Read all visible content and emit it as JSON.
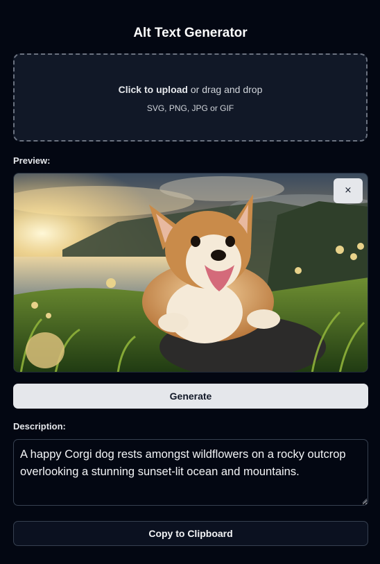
{
  "app": {
    "title": "Alt Text Generator"
  },
  "upload": {
    "click_label": "Click to upload",
    "drag_label": " or drag and drop",
    "formats": "SVG, PNG, JPG or GIF"
  },
  "preview": {
    "label": "Preview:",
    "image_subject": "corgi-sunset-photo",
    "remove_button_label": "×"
  },
  "actions": {
    "generate_label": "Generate",
    "copy_label": "Copy to Clipboard"
  },
  "description": {
    "label": "Description:",
    "value": "A happy Corgi dog rests amongst wildflowers on a rocky outcrop overlooking a stunning sunset-lit ocean and mountains."
  },
  "colors": {
    "background": "#030712",
    "panel": "#111827",
    "button_light": "#e5e7eb",
    "border": "#374151"
  }
}
